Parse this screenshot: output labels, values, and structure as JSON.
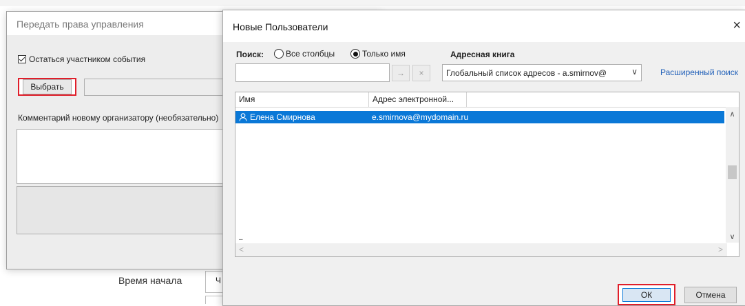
{
  "background": {
    "start_time_label": "Время начала",
    "start_field_text": "Ч"
  },
  "transfer_dialog": {
    "title": "Передать права управления",
    "stay_participant_label": "Остаться участником события",
    "stay_participant_checked": true,
    "pick_button_label": "Выбрать",
    "comment_label": "Комментарий новому организатору (необязательно)",
    "comment_value": ""
  },
  "users_dialog": {
    "title": "Новые Пользователи",
    "close_glyph": "×",
    "search_label": "Поиск:",
    "radio_all_columns": "Все столбцы",
    "radio_name_only": "Только имя",
    "selected_radio": "name_only",
    "search_value": "",
    "go_glyph": "→",
    "clear_glyph": "×",
    "address_book_label": "Адресная книга",
    "address_book_value": "Глобальный список адресов - a.smirnov@",
    "advanced_search": "Расширенный поиск",
    "columns": [
      "Имя",
      "Адрес электронной..."
    ],
    "rows": [
      {
        "name": "Елена Смирнова",
        "email": "e.smirnova@mydomain.ru",
        "selected": true
      }
    ],
    "ok_label": "ОК",
    "cancel_label": "Отмена",
    "accent_color": "#0a78d7",
    "highlight_color": "#e01e2a"
  }
}
